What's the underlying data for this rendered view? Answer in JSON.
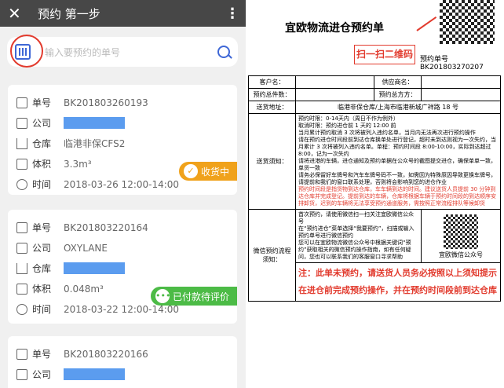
{
  "app": {
    "title": "预约 第一步",
    "close": "✕",
    "more": "⋮"
  },
  "search": {
    "placeholder": "输入要预约的单号"
  },
  "labels": {
    "order": "单号",
    "company": "公司",
    "warehouse": "仓库",
    "volume": "体积",
    "time": "时间"
  },
  "cards": [
    {
      "order": "BK201803260193",
      "warehouse": "临港非保CFS2",
      "volume": "3.3m³",
      "time": "2018-03-26 12:00-14:00",
      "badge": "收货中"
    },
    {
      "order": "BK201803220164",
      "company": "OXYLANE",
      "volume": "0.048m³",
      "time": "2018-03-22 12:00-14:00",
      "badge": "已付款待评价"
    },
    {
      "order": "BK201803220166"
    }
  ],
  "doc": {
    "title": "宜欧物流进仓预约单",
    "callout": "扫一扫二维码",
    "order_no": "预约单号 BK201803270207",
    "cells": {
      "client": "客户名：",
      "supplier": "供应商名：",
      "total_pieces": "预约总件数：",
      "total_volume": "预约总方方：",
      "addr_label": "送货地址：",
      "addr": "临港非保仓库/上海市临港新城广祥路 18 号",
      "notice_label": "送货须知：",
      "process_label": "微信预约流程",
      "process_sub": "须知：",
      "qr_caption": "宜欧微信公众号"
    },
    "notices": [
      "预约时限：0-14天内（周日不作为例外）",
      "取消时限：预约进仓前 1 天的 12:00 前",
      "当月累计预约取消 3 次将被列入违约名单，当月内无法再次进行预约操作",
      "请在预约进仓时间段前到达仓库换单处进行登记，超时未到达则视为一次失约，当月累计 3 次将被列入违约名单。单程：预约时间段 8:00-10:00，实际到达超过 8:00，记为一次失约",
      "请将进港的车辆，进仓通知及预约单据在公众号的截图提交进仓，确保单单一致，单货一致",
      "请务必保留好车牌号和汽车车牌号码不一致，如需因为特殊原因导致更换车牌号，请提前和我们的窗口联系处理，否则将会影响到您的进仓作业",
      "预约时间段是指货物到达仓库，车车辆到达的时间。建议送货人员提前 30 分钟到达仓库并完成登记。提前到达的车辆，仓库将根据车辆于预约时间段的到达顺序安排卸货，迟到的车辆将无法享受预约通道服务，需按照正常流程排队等候卸货"
    ],
    "process": [
      "首次预约，请使用微信扫一扫关注宜欧微信公众号",
      "在“预约进仓”菜单选择“我要预约”，扫描或输入预约单号进行微信预约",
      "您可以在宜欧物流微信公众号中根据关键词“预约”获取相关的微信预约操作指南，如有任何疑问，您也可以联系我们的客服窗口寻求帮助"
    ],
    "warning": "注：此单未预约，请送货人员务必按照以上须知提示在进仓前完成预约操作，并在预约时间段前到达仓库"
  },
  "colors": {
    "topbar": "#474747",
    "blue": "#3e67d6",
    "orange": "#f0a21b",
    "green": "#4cbb46",
    "red": "#e23b2e"
  }
}
